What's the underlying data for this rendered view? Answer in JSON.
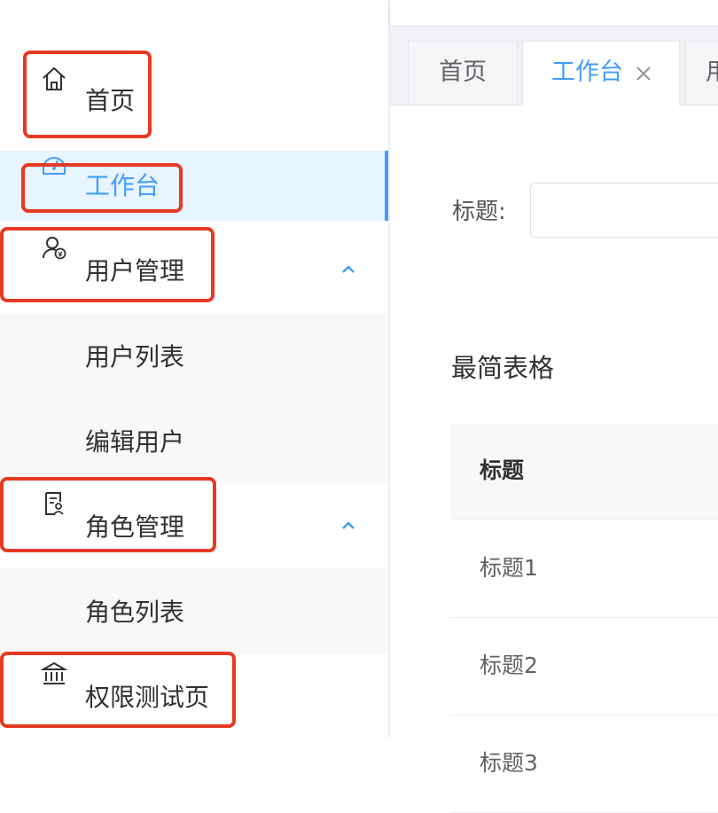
{
  "sidebar": {
    "items": [
      {
        "label": "首页",
        "icon": "home-icon"
      },
      {
        "label": "工作台",
        "icon": "dashboard-icon",
        "active": true
      },
      {
        "label": "用户管理",
        "icon": "user-money-icon",
        "expanded": true,
        "children": [
          {
            "label": "用户列表"
          },
          {
            "label": "编辑用户"
          }
        ]
      },
      {
        "label": "角色管理",
        "icon": "document-role-icon",
        "expanded": true,
        "children": [
          {
            "label": "角色列表"
          }
        ]
      },
      {
        "label": "权限测试页",
        "icon": "bank-icon"
      }
    ]
  },
  "tabs": [
    {
      "label": "首页",
      "active": false
    },
    {
      "label": "工作台",
      "active": true,
      "closable": true
    },
    {
      "label": "用",
      "active": false
    }
  ],
  "form": {
    "title_label": "标题:",
    "title_value": "",
    "title_placeholder": ""
  },
  "section": {
    "title": "最简表格"
  },
  "table": {
    "headers": [
      "标题"
    ],
    "rows": [
      [
        "标题1"
      ],
      [
        "标题2"
      ],
      [
        "标题3"
      ]
    ]
  },
  "colors": {
    "accent": "#409eff",
    "highlight": "#e63a23",
    "active_bg": "#e8f4ff",
    "submenu_bg": "#f8f8f9"
  }
}
